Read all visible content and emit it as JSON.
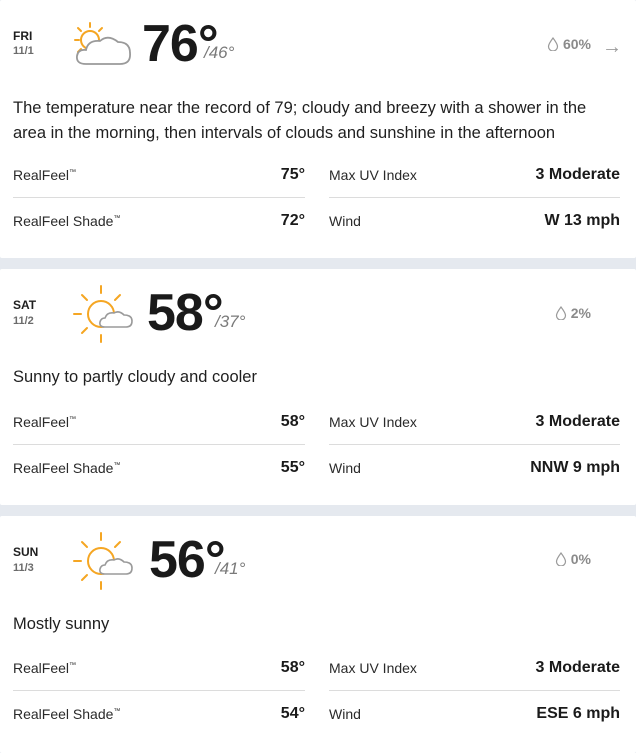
{
  "days": [
    {
      "dow": "FRI",
      "date": "11/1",
      "icon": "partly-sunny-icon",
      "high": "76°",
      "low": "/46°",
      "precip": "60%",
      "phrase": "The temperature near the record of 79; cloudy and breezy with a shower in the area in the morning, then intervals of clouds and sunshine in the afternoon",
      "realfeel_label": "RealFeel",
      "realfeel_tm": "™",
      "realfeel": "75°",
      "realfeel_shade_label": "RealFeel Shade",
      "realfeel_shade_tm": "™",
      "realfeel_shade": "72°",
      "uv_label": "Max UV Index",
      "uv": "3 Moderate",
      "wind_label": "Wind",
      "wind": "W 13 mph"
    },
    {
      "dow": "SAT",
      "date": "11/2",
      "icon": "mostly-sunny-icon",
      "high": "58°",
      "low": "/37°",
      "precip": "2%",
      "phrase": "Sunny to partly cloudy and cooler",
      "realfeel_label": "RealFeel",
      "realfeel_tm": "™",
      "realfeel": "58°",
      "realfeel_shade_label": "RealFeel Shade",
      "realfeel_shade_tm": "™",
      "realfeel_shade": "55°",
      "uv_label": "Max UV Index",
      "uv": "3 Moderate",
      "wind_label": "Wind",
      "wind": "NNW 9 mph"
    },
    {
      "dow": "SUN",
      "date": "11/3",
      "icon": "mostly-sunny-icon",
      "high": "56°",
      "low": "/41°",
      "precip": "0%",
      "phrase": "Mostly sunny",
      "realfeel_label": "RealFeel",
      "realfeel_tm": "™",
      "realfeel": "58°",
      "realfeel_shade_label": "RealFeel Shade",
      "realfeel_shade_tm": "™",
      "realfeel_shade": "54°",
      "uv_label": "Max UV Index",
      "uv": "3 Moderate",
      "wind_label": "Wind",
      "wind": "ESE 6 mph"
    }
  ],
  "arrow_icon": "arrow-right-icon",
  "colors": {
    "sun": "#f5a623",
    "cloud_stroke": "#9a9a9a",
    "page_bg": "#e5e9ef"
  }
}
